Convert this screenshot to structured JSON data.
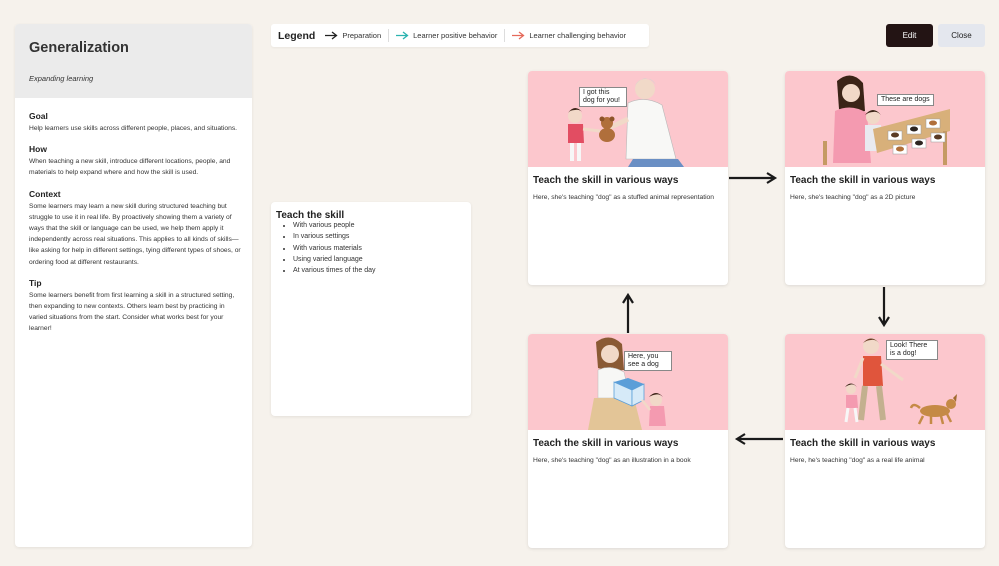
{
  "side": {
    "title": "Generalization",
    "subtitle": "Expanding learning",
    "sections": [
      {
        "heading": "Goal",
        "text": "Help learners use skills across different people, places, and situations."
      },
      {
        "heading": "How",
        "text": "When teaching a new skill, introduce different locations, people, and materials to help expand where and how the skill is used."
      },
      {
        "heading": "Context",
        "text": "Some learners may learn a new skill during structured teaching but struggle to use it in real life. By proactively showing them a variety of ways that the skill or language can be used, we help them apply it independently across real situations. This applies to all kinds of skills—like asking for help in different settings, tying different types of shoes, or ordering food at different restaurants."
      },
      {
        "heading": "Tip",
        "text": "Some learners benefit from first learning a skill in a structured setting, then expanding to new contexts. Others learn best by practicing in varied situations from the start. Consider what works best for your learner!"
      }
    ]
  },
  "legend": {
    "title": "Legend",
    "items": [
      {
        "label": "Preparation",
        "color": "#222222"
      },
      {
        "label": "Learner positive behavior",
        "color": "#2bb3b0"
      },
      {
        "label": "Learner challenging behavior",
        "color": "#e56a5b"
      }
    ]
  },
  "buttons": {
    "edit": "Edit",
    "close": "Close"
  },
  "teach": {
    "title": "Teach the skill",
    "items": [
      "With various people",
      "In various settings",
      "With various materials",
      "Using varied language",
      "At various times of the day"
    ]
  },
  "cards": [
    {
      "title": "Teach the skill in various ways",
      "desc": "Here, she's teaching \"dog\" as a stuffed animal representation",
      "bubble": "I got this dog for you!"
    },
    {
      "title": "Teach the skill in various ways",
      "desc": "Here, she's teaching \"dog\" as a 2D picture",
      "bubble": "These are dogs"
    },
    {
      "title": "Teach the skill in various ways",
      "desc": "Here, he's teaching \"dog\" as a real life animal",
      "bubble": "Look! There is a dog!"
    },
    {
      "title": "Teach the skill in various ways",
      "desc": "Here, she's teaching \"dog\" as an illustration in a book",
      "bubble": "Here, you see a dog"
    }
  ]
}
